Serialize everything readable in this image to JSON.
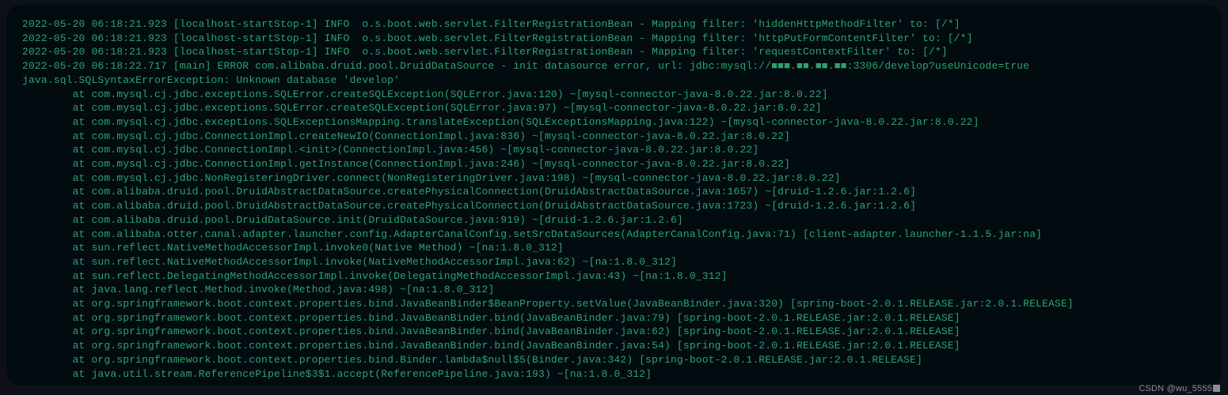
{
  "lines": [
    "2022-05-20 06:18:21.923 [localhost-startStop-1] INFO  o.s.boot.web.servlet.FilterRegistrationBean - Mapping filter: 'hiddenHttpMethodFilter' to: [/*]",
    "2022-05-20 06:18:21.923 [localhost-startStop-1] INFO  o.s.boot.web.servlet.FilterRegistrationBean - Mapping filter: 'httpPutFormContentFilter' to: [/*]",
    "2022-05-20 06:18:21.923 [localhost-startStop-1] INFO  o.s.boot.web.servlet.FilterRegistrationBean - Mapping filter: 'requestContextFilter' to: [/*]",
    "2022-05-20 06:18:22.717 [main] ERROR com.alibaba.druid.pool.DruidDataSource - init datasource error, url: jdbc:mysql://■■■.■■.■■.■■:3306/develop?useUnicode=true",
    "java.sql.SQLSyntaxErrorException: Unknown database 'develop'",
    "        at com.mysql.cj.jdbc.exceptions.SQLError.createSQLException(SQLError.java:120) ~[mysql-connector-java-8.0.22.jar:8.0.22]",
    "        at com.mysql.cj.jdbc.exceptions.SQLError.createSQLException(SQLError.java:97) ~[mysql-connector-java-8.0.22.jar:8.0.22]",
    "        at com.mysql.cj.jdbc.exceptions.SQLExceptionsMapping.translateException(SQLExceptionsMapping.java:122) ~[mysql-connector-java-8.0.22.jar:8.0.22]",
    "        at com.mysql.cj.jdbc.ConnectionImpl.createNewIO(ConnectionImpl.java:836) ~[mysql-connector-java-8.0.22.jar:8.0.22]",
    "        at com.mysql.cj.jdbc.ConnectionImpl.<init>(ConnectionImpl.java:456) ~[mysql-connector-java-8.0.22.jar:8.0.22]",
    "        at com.mysql.cj.jdbc.ConnectionImpl.getInstance(ConnectionImpl.java:246) ~[mysql-connector-java-8.0.22.jar:8.0.22]",
    "        at com.mysql.cj.jdbc.NonRegisteringDriver.connect(NonRegisteringDriver.java:198) ~[mysql-connector-java-8.0.22.jar:8.0.22]",
    "        at com.alibaba.druid.pool.DruidAbstractDataSource.createPhysicalConnection(DruidAbstractDataSource.java:1657) ~[druid-1.2.6.jar:1.2.6]",
    "        at com.alibaba.druid.pool.DruidAbstractDataSource.createPhysicalConnection(DruidAbstractDataSource.java:1723) ~[druid-1.2.6.jar:1.2.6]",
    "        at com.alibaba.druid.pool.DruidDataSource.init(DruidDataSource.java:919) ~[druid-1.2.6.jar:1.2.6]",
    "        at com.alibaba.otter.canal.adapter.launcher.config.AdapterCanalConfig.setSrcDataSources(AdapterCanalConfig.java:71) [client-adapter.launcher-1.1.5.jar:na]",
    "        at sun.reflect.NativeMethodAccessorImpl.invoke0(Native Method) ~[na:1.8.0_312]",
    "        at sun.reflect.NativeMethodAccessorImpl.invoke(NativeMethodAccessorImpl.java:62) ~[na:1.8.0_312]",
    "        at sun.reflect.DelegatingMethodAccessorImpl.invoke(DelegatingMethodAccessorImpl.java:43) ~[na:1.8.0_312]",
    "        at java.lang.reflect.Method.invoke(Method.java:498) ~[na:1.8.0_312]",
    "        at org.springframework.boot.context.properties.bind.JavaBeanBinder$BeanProperty.setValue(JavaBeanBinder.java:320) [spring-boot-2.0.1.RELEASE.jar:2.0.1.RELEASE]",
    "        at org.springframework.boot.context.properties.bind.JavaBeanBinder.bind(JavaBeanBinder.java:79) [spring-boot-2.0.1.RELEASE.jar:2.0.1.RELEASE]",
    "        at org.springframework.boot.context.properties.bind.JavaBeanBinder.bind(JavaBeanBinder.java:62) [spring-boot-2.0.1.RELEASE.jar:2.0.1.RELEASE]",
    "        at org.springframework.boot.context.properties.bind.JavaBeanBinder.bind(JavaBeanBinder.java:54) [spring-boot-2.0.1.RELEASE.jar:2.0.1.RELEASE]",
    "        at org.springframework.boot.context.properties.bind.Binder.lambda$null$5(Binder.java:342) [spring-boot-2.0.1.RELEASE.jar:2.0.1.RELEASE]",
    "        at java.util.stream.ReferencePipeline$3$1.accept(ReferencePipeline.java:193) ~[na:1.8.0_312]"
  ],
  "watermark": "CSDN @wu_5555"
}
